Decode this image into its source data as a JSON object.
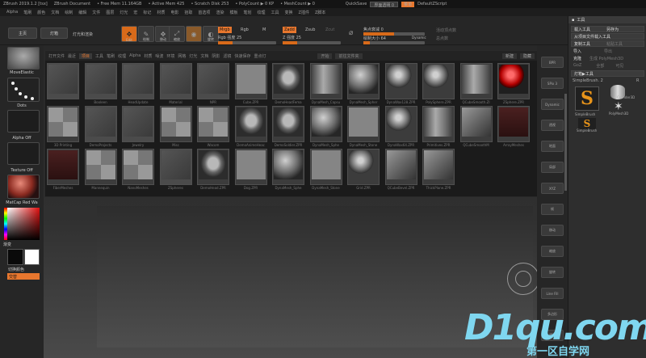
{
  "titlebar": {
    "title": "ZBrush 2019.1.2 [tsx]",
    "doc": "ZBrush Document",
    "free_mem": "• Free Mem 11.164GB",
    "active_mem": "• Active Mem 425",
    "scratch": "• Scratch Disk 253",
    "poly": "• PolyCount ▶ 0 KP",
    "mesh": "• MeshCount ▶ 0",
    "quicksave": "QuickSave",
    "transparency": "界面透明 0",
    "menus_btn": "菜单",
    "script": "DefaultZScript"
  },
  "menubar": [
    "Alpha",
    "笔刷",
    "颜色",
    "文档",
    "绘制",
    "编辑",
    "文件",
    "图层",
    "灯光",
    "宏",
    "标记",
    "材质",
    "电影",
    "拾取",
    "首选项",
    "渲染",
    "模板",
    "笔划",
    "纹理",
    "工具",
    "变换",
    "Z插件",
    "Z脚本"
  ],
  "topshelf": {
    "home": "主页",
    "lightbox": "灯箱",
    "lightbox_extra": "灯光和渲染",
    "edit": "Edit",
    "draw": "绘制",
    "move": "移动",
    "scale": "缩放",
    "rotate": "旋转",
    "mrgb": "Mrgb",
    "rgb": "Rgb",
    "m": "M",
    "rgb_intensity": "Rgb 强度 25",
    "zadd": "Zadd",
    "zsub": "Zsub",
    "zcut": "Zcut",
    "z_intensity": "Z 强度 25",
    "focal_shift": "焦点衰减 0",
    "draw_size": "绘制大小 64",
    "dynamic": "Dynamic",
    "active_points": "活动顶点数",
    "total_points": "总点数"
  },
  "leftshelf": {
    "brush_label": "MoveElastic",
    "stroke_label": "Dots",
    "alpha_label": "Alpha Off",
    "texture_label": "Texture Off",
    "material_label": "MatCap Red Wa",
    "gradient_label": "渐变",
    "switch_label": "切换颜色",
    "alt_label": "交替"
  },
  "lightbox": {
    "tabs": [
      "打开文件",
      "最近",
      "项目",
      "工具",
      "笔刷",
      "纹理",
      "Alpha",
      "材质",
      "噪波",
      "环境",
      "网格",
      "灯光",
      "文档",
      "阴影",
      "滤镜",
      "快速保存",
      "重点灯"
    ],
    "active_tab": "项目",
    "right_buttons": [
      "开始",
      "前往文件夹"
    ],
    "far_right": [
      "新建",
      "隐藏"
    ],
    "items": [
      {
        "name": "",
        "kind": "folder"
      },
      {
        "name": "Booleen",
        "kind": "folder"
      },
      {
        "name": "HeadUpdate",
        "kind": "folder"
      },
      {
        "name": "Material",
        "kind": "folder"
      },
      {
        "name": "NPR",
        "kind": "folder"
      },
      {
        "name": "Cube.ZPR",
        "kind": "flat"
      },
      {
        "name": "DemoHeadFema",
        "kind": "head"
      },
      {
        "name": "DynaMesh_Capsu",
        "kind": "cyl"
      },
      {
        "name": "DynaMesh_Spher",
        "kind": "sphere"
      },
      {
        "name": "DynaWax128.ZPR",
        "kind": "ball"
      },
      {
        "name": "PolySphere.ZPR",
        "kind": "ball"
      },
      {
        "name": "QCubeSmooth.ZI",
        "kind": "cyl"
      },
      {
        "name": "ZSphere.ZPR",
        "kind": "red"
      },
      {
        "name": "3D Printing",
        "kind": "grid4"
      },
      {
        "name": "DemoProjects",
        "kind": "folder"
      },
      {
        "name": "Jewelry",
        "kind": "folder"
      },
      {
        "name": "Misc",
        "kind": "grid4"
      },
      {
        "name": "Wacom",
        "kind": "grid4"
      },
      {
        "name": "DemoAnimeHeac",
        "kind": "head"
      },
      {
        "name": "DemoSoldier.ZPR",
        "kind": "head"
      },
      {
        "name": "DynaMesh_Sphe",
        "kind": "sphere"
      },
      {
        "name": "DynaMesh_Stone",
        "kind": "flat"
      },
      {
        "name": "DynaWax64.ZPR",
        "kind": "ball"
      },
      {
        "name": "Primitives.ZPR",
        "kind": "cyl"
      },
      {
        "name": "QCubeSmoothM",
        "kind": "box"
      },
      {
        "name": "ArrayMeshes",
        "kind": "scene"
      },
      {
        "name": "FiberMeshes",
        "kind": "scene"
      },
      {
        "name": "Mannequin",
        "kind": "grid4"
      },
      {
        "name": "NanoMeshes",
        "kind": "grid4"
      },
      {
        "name": "ZSpheres",
        "kind": "folder"
      },
      {
        "name": "DemoHead.ZPR",
        "kind": "head"
      },
      {
        "name": "Dog.ZPR",
        "kind": "flat"
      },
      {
        "name": "DynaMesh_Sphe",
        "kind": "sphere"
      },
      {
        "name": "DynaMesh_Stone",
        "kind": "flat"
      },
      {
        "name": "Grid.ZPR",
        "kind": "ball"
      },
      {
        "name": "QCubeBevel.ZPR",
        "kind": "box"
      },
      {
        "name": "ThickPlane.ZPR",
        "kind": "box"
      }
    ]
  },
  "rightshelf": [
    "BPR",
    "SPix 3",
    "Dynamic",
    "透视",
    "地面",
    "局部",
    "XYZ",
    "帧",
    "移动",
    "缩放",
    "旋转",
    "Line Fill",
    "多边形",
    "透明"
  ],
  "toolpanel": {
    "header": "工具",
    "load_tool": "载入工具",
    "save_as": "另存为",
    "copy_from_project": "从项目文件载入工具",
    "copy_tool": "复制工具",
    "paste_tool": "粘贴工具",
    "import": "导入",
    "export": "导出",
    "clone": "克隆",
    "make_polymesh": "生成 PolyMesh3D",
    "goz": "GoZ",
    "all": "全部",
    "visible": "可见",
    "lightbox_tools": "灯箱▶工具",
    "brush_name": "SimpleBrush. 2",
    "brush_num": "R",
    "tools": [
      "SimpleBrush",
      "Cylinder3D",
      "PolyMesh3D",
      "SimpleBrush"
    ]
  },
  "watermark": {
    "main": "D1qu.com",
    "sub": "第一区自学网"
  }
}
